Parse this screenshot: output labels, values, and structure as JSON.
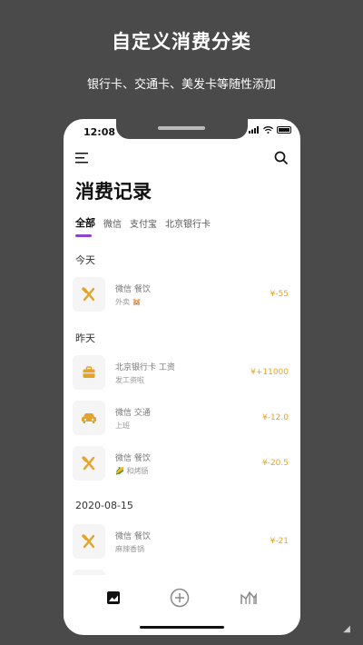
{
  "promo": {
    "title": "自定义消费分类",
    "subtitle": "银行卡、交通卡、美发卡等随性添加"
  },
  "status_bar": {
    "time": "12:08"
  },
  "header": {
    "title": "消费记录"
  },
  "tabs": [
    {
      "label": "全部"
    },
    {
      "label": "微信"
    },
    {
      "label": "支付宝"
    },
    {
      "label": "北京银行卡"
    }
  ],
  "sections": [
    {
      "label": "今天",
      "rows": [
        {
          "icon": "utensils-icon",
          "category": "微信 餐饮",
          "note": "外卖 🐹",
          "amount": "¥-55"
        }
      ]
    },
    {
      "label": "昨天",
      "rows": [
        {
          "icon": "briefcase-icon",
          "category": "北京银行卡 工资",
          "note": "发工资啦",
          "amount": "¥+11000"
        },
        {
          "icon": "car-icon",
          "category": "微信 交通",
          "note": "上班",
          "amount": "¥-12.0"
        },
        {
          "icon": "utensils-icon",
          "category": "微信 餐饮",
          "note": "🌽 和烤肠",
          "amount": "¥-20.5"
        }
      ]
    },
    {
      "label": "2020-08-15",
      "rows": [
        {
          "icon": "utensils-icon",
          "category": "微信 餐饮",
          "note": "麻辣香锅",
          "amount": "¥-21"
        }
      ]
    }
  ],
  "colors": {
    "accent": "#8e44c7",
    "amount": "#e4a32a",
    "icon": "#e4a32a"
  },
  "bottom_nav": [
    "home-icon",
    "add-circle-icon",
    "chart-icon"
  ]
}
